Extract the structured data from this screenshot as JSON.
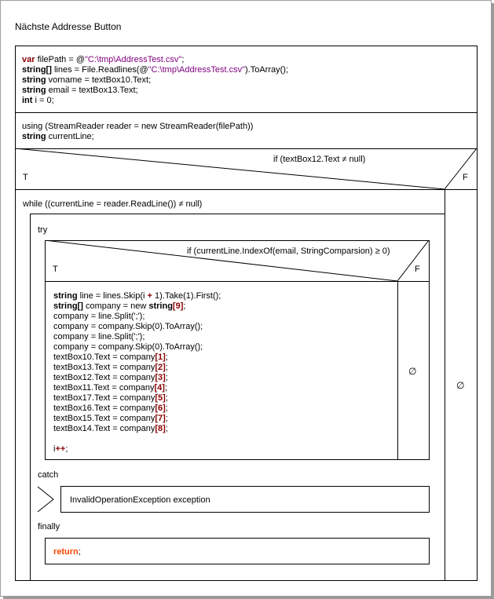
{
  "title": "Nächste Addresse Button",
  "decl_block": {
    "lines": [
      [
        {
          "t": "var",
          "c": "kwr"
        },
        {
          "t": " filePath = @"
        },
        {
          "t": "\"C:\\tmp\\AddressTest.csv\"",
          "c": "str"
        },
        {
          "t": ";"
        }
      ],
      [
        {
          "t": "string[]",
          "c": "kw"
        },
        {
          "t": " lines = File.Readlines(@"
        },
        {
          "t": "\"C:\\tmp\\AddressTest.csv\"",
          "c": "str"
        },
        {
          "t": ").ToArray();"
        }
      ],
      [
        {
          "t": "string",
          "c": "kw"
        },
        {
          "t": " vorname = textBox10.Text;"
        }
      ],
      [
        {
          "t": "string",
          "c": "kw"
        },
        {
          "t": " email = textBox13.Text;"
        }
      ],
      [
        {
          "t": "int",
          "c": "kw"
        },
        {
          "t": " i = 0;"
        }
      ]
    ]
  },
  "using_block": {
    "lines": [
      [
        {
          "t": "using (StreamReader reader = new StreamReader(filePath))"
        }
      ],
      [
        {
          "t": "string",
          "c": "kw"
        },
        {
          "t": " currentLine;"
        }
      ]
    ]
  },
  "if_outer": {
    "condition": "if (textBox12.Text ≠ null)",
    "true_label": "T",
    "false_label": "F",
    "false_branch": "∅"
  },
  "while_label": "while ((currentLine = reader.ReadLine()) ≠ null)",
  "try_label": "try",
  "if_inner": {
    "condition": "if (currentLine.IndexOf(email, StringComparsion) ≥ 0)",
    "true_label": "T",
    "false_label": "F",
    "false_branch": "∅"
  },
  "inner_block": {
    "lines": [
      [
        {
          "t": "string",
          "c": "kw"
        },
        {
          "t": " line = lines.Skip(i "
        },
        {
          "t": "+",
          "c": "red"
        },
        {
          "t": " 1).Take(1).First();"
        }
      ],
      [
        {
          "t": "string[]",
          "c": "kw"
        },
        {
          "t": " company = new "
        },
        {
          "t": "string",
          "c": "kw"
        },
        {
          "t": "[9]",
          "c": "red"
        },
        {
          "t": ";"
        }
      ],
      [
        {
          "t": "company = line.Split(';');"
        }
      ],
      [
        {
          "t": "company = company.Skip(0).ToArray();"
        }
      ],
      [
        {
          "t": "company = line.Split(';');"
        }
      ],
      [
        {
          "t": "company = company.Skip(0).ToArray();"
        }
      ],
      [
        {
          "t": "textBox10.Text = company"
        },
        {
          "t": "[1]",
          "c": "red"
        },
        {
          "t": ";"
        }
      ],
      [
        {
          "t": "textBox13.Text = company"
        },
        {
          "t": "[2]",
          "c": "red"
        },
        {
          "t": ";"
        }
      ],
      [
        {
          "t": "textBox12.Text = company"
        },
        {
          "t": "[3]",
          "c": "red"
        },
        {
          "t": ";"
        }
      ],
      [
        {
          "t": "textBox11.Text = company"
        },
        {
          "t": "[4]",
          "c": "red"
        },
        {
          "t": ";"
        }
      ],
      [
        {
          "t": "textBox17.Text = company"
        },
        {
          "t": "[5]",
          "c": "red"
        },
        {
          "t": ";"
        }
      ],
      [
        {
          "t": "textBox16.Text = company"
        },
        {
          "t": "[6]",
          "c": "red"
        },
        {
          "t": ";"
        }
      ],
      [
        {
          "t": "textBox15.Text = company"
        },
        {
          "t": "[7]",
          "c": "red"
        },
        {
          "t": ";"
        }
      ],
      [
        {
          "t": "textBox14.Text = company"
        },
        {
          "t": "[8]",
          "c": "red"
        },
        {
          "t": ";"
        }
      ],
      [
        {
          "t": ""
        }
      ],
      [
        {
          "t": "i"
        },
        {
          "t": "++",
          "c": "red"
        },
        {
          "t": ";"
        }
      ]
    ]
  },
  "catch_label": "catch",
  "catch_text": "InvalidOperationException exception",
  "finally_label": "finally",
  "finally_block": {
    "lines": [
      [
        {
          "t": "return",
          "c": "ret"
        },
        {
          "t": ";"
        }
      ]
    ]
  }
}
